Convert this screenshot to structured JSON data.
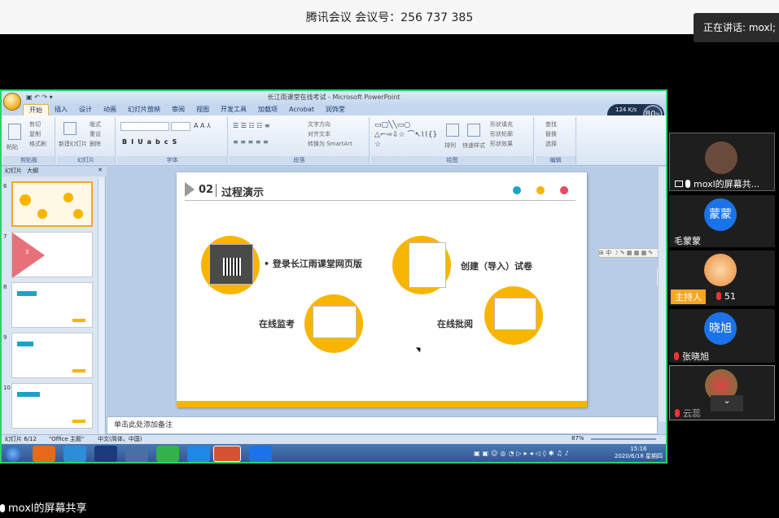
{
  "meeting": {
    "title": "腾讯会议 会议号：256 737 385",
    "speaking": "正在讲话: moxl;",
    "share_label": "moxl的屏幕共享"
  },
  "ppt": {
    "window_title": "长江雨课堂在线考试 - Microsoft PowerPoint",
    "tabs": [
      "开始",
      "插入",
      "设计",
      "动画",
      "幻灯片放映",
      "审阅",
      "视图",
      "开发工具",
      "加载项",
      "Acrobat",
      "润饰堂"
    ],
    "groups": [
      "剪贴板",
      "幻灯片",
      "字体",
      "段落",
      "绘图",
      "编辑"
    ],
    "clipboard": [
      "剪切",
      "复制",
      "格式刷",
      "粘贴"
    ],
    "slides_group": [
      "版式",
      "重设",
      "删除",
      "新建幻灯片"
    ],
    "paragraph": [
      "文字方向",
      "对齐文本",
      "转换为 SmartArt"
    ],
    "drawing": [
      "排列",
      "快速样式",
      "形状填充",
      "形状轮廓",
      "形状效果"
    ],
    "editing": [
      "查找",
      "替换",
      "选择"
    ],
    "perf": {
      "speed": "124",
      "unit": "K/s",
      "percent": "80",
      "percent_unit": "%"
    },
    "left_tabs": [
      "幻灯片",
      "大纲"
    ],
    "thumbs": [
      {
        "num": "6"
      },
      {
        "num": "7",
        "label": "3"
      },
      {
        "num": "8"
      },
      {
        "num": "9"
      },
      {
        "num": "10"
      }
    ],
    "slide": {
      "section_num": "02",
      "section_title": "过程演示",
      "items": [
        "• 登录长江雨课堂网页版",
        "创建（导入）试卷",
        "在线监考",
        "在线批阅"
      ]
    },
    "notes": "单击此处添加备注",
    "status": {
      "slide": "幻灯片 6/12",
      "theme": "\"Office 主题\"",
      "lang": "中文(简体，中国)",
      "zoom": "87%"
    },
    "clock": {
      "time": "15:16",
      "date": "2020/6/18 星期四"
    }
  },
  "participants": [
    {
      "name": "moxl的屏幕共...",
      "avatar": ""
    },
    {
      "name": "毛蒙蒙",
      "avatar": "蒙蒙",
      "color": "#1a73e8"
    },
    {
      "name": "主持人",
      "extra": "51",
      "avatar": ""
    },
    {
      "name": "张晓旭",
      "avatar": "晓旭",
      "color": "#1a73e8"
    },
    {
      "name": "云蕊",
      "avatar": ""
    }
  ],
  "colors": {
    "accent": "#f8b500",
    "dot1": "#1aa3c8",
    "dot2": "#f8b500",
    "dot3": "#e84a5f",
    "border": "#2fd06a"
  }
}
